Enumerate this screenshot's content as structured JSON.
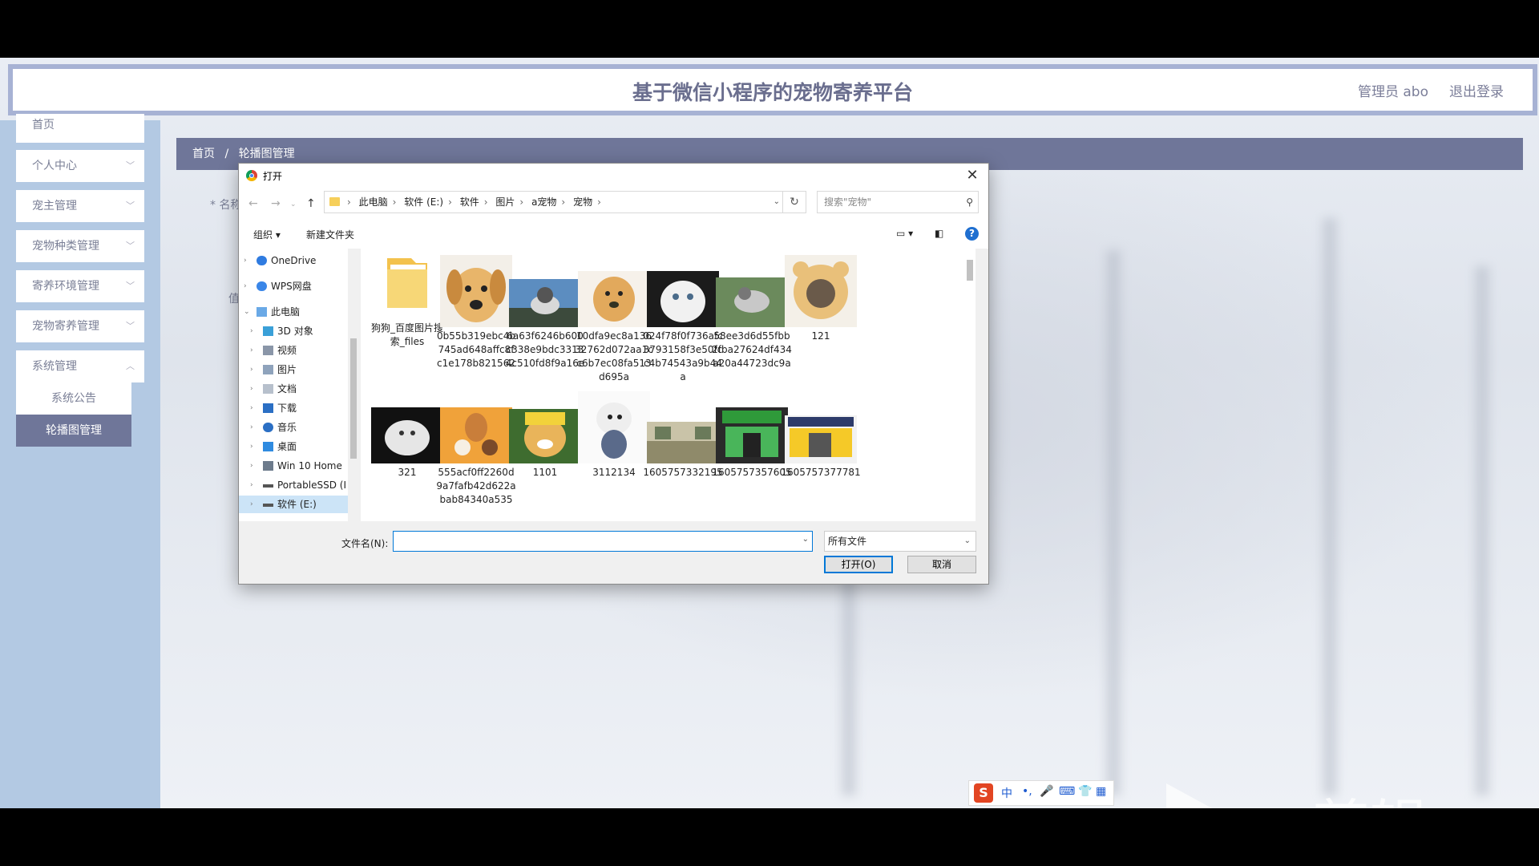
{
  "header": {
    "title": "基于微信小程序的宠物寄养平台",
    "admin": "管理员 abo",
    "logout": "退出登录"
  },
  "sidebar": {
    "items": [
      {
        "label": "首页"
      },
      {
        "label": "个人中心"
      },
      {
        "label": "宠主管理"
      },
      {
        "label": "宠物种类管理"
      },
      {
        "label": "寄养环境管理"
      },
      {
        "label": "宠物寄养管理"
      },
      {
        "label": "系统管理"
      }
    ],
    "sub_items": [
      {
        "label": "系统公告"
      },
      {
        "label": "轮播图管理"
      }
    ]
  },
  "breadcrumb": {
    "home": "首页",
    "sep": "/",
    "current": "轮播图管理"
  },
  "form": {
    "name_label": "* 名称",
    "value_label": "值"
  },
  "dialog": {
    "title": "打开",
    "close": "✕",
    "address": [
      "此电脑",
      "软件 (E:)",
      "软件",
      "图片",
      "a宠物",
      "宠物"
    ],
    "search_placeholder": "搜索\"宠物\"",
    "organize": "组织 ▾",
    "new_folder": "新建文件夹",
    "tree": [
      {
        "label": "OneDrive"
      },
      {
        "label": "WPS网盘"
      },
      {
        "label": "此电脑"
      },
      {
        "label": "3D 对象"
      },
      {
        "label": "视频"
      },
      {
        "label": "图片"
      },
      {
        "label": "文档"
      },
      {
        "label": "下载"
      },
      {
        "label": "音乐"
      },
      {
        "label": "桌面"
      },
      {
        "label": "Win 10 Home"
      },
      {
        "label": "PortableSSD (I"
      },
      {
        "label": "软件 (E:)"
      }
    ],
    "files": [
      {
        "name": "狗狗_百度图片搜索_files",
        "kind": "folder"
      },
      {
        "name": "0b55b319ebc4b745ad648affc8fc1e178b821562",
        "kind": "dog-face"
      },
      {
        "name": "6a63f6246b600c338e9bdc33134c510fd8f9a16e",
        "kind": "husky"
      },
      {
        "name": "10dfa9ec8a13632762d072aa1cc6b7ec08fa513d695a",
        "kind": "lab"
      },
      {
        "name": "024f78f0f736afc3793158f3e50fcc4b74543a9b44a",
        "kind": "white-cat"
      },
      {
        "name": "58ee3d6d55fbb2fba27624df434a20a44723dc9a",
        "kind": "husky2"
      },
      {
        "name": "121",
        "kind": "cat-hat"
      },
      {
        "name": "321",
        "kind": "kitten"
      },
      {
        "name": "555acf0ff2260d9a7fafb42d622abab84340a535",
        "kind": "dog-food"
      },
      {
        "name": "1101",
        "kind": "shiba"
      },
      {
        "name": "3112134",
        "kind": "bichon"
      },
      {
        "name": "1605757332195",
        "kind": "room"
      },
      {
        "name": "1605757357605",
        "kind": "shop-green"
      },
      {
        "name": "1605757377781",
        "kind": "shop-yellow"
      }
    ],
    "filename_label": "文件名(N):",
    "filename_value": "",
    "filetype": "所有文件",
    "open_button": "打开(O)",
    "cancel_button": "取消"
  },
  "ime": {
    "logo": "S",
    "lang": "中"
  },
  "watermark": "ev剪辑"
}
